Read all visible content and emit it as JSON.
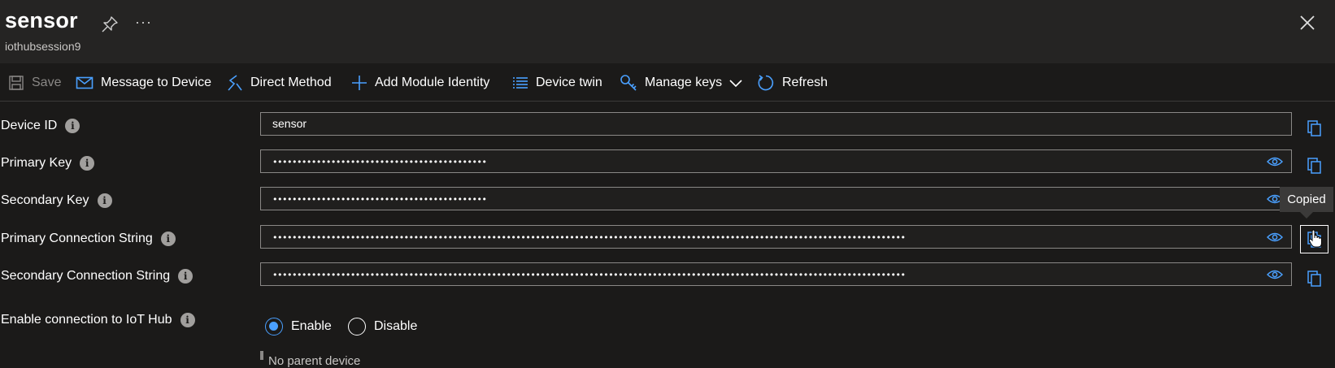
{
  "header": {
    "title": "sensor",
    "subtitle": "iothubsession9",
    "more": "···"
  },
  "toolbar": {
    "save": "Save",
    "message_to_device": "Message to Device",
    "direct_method": "Direct Method",
    "add_module_identity": "Add Module Identity",
    "device_twin": "Device twin",
    "manage_keys": "Manage keys",
    "refresh": "Refresh"
  },
  "form": {
    "device_id": {
      "label": "Device ID",
      "value": "sensor"
    },
    "primary_key": {
      "label": "Primary Key",
      "value": "••••••••••••••••••••••••••••••••••••••••••••"
    },
    "secondary_key": {
      "label": "Secondary Key",
      "value": "••••••••••••••••••••••••••••••••••••••••••••"
    },
    "primary_connection_string": {
      "label": "Primary Connection String",
      "value": "••••••••••••••••••••••••••••••••••••••••••••••••••••••••••••••••••••••••••••••••••••••••••••••••••••••••••••••••••••••••••••••••••"
    },
    "secondary_connection_string": {
      "label": "Secondary Connection String",
      "value": "••••••••••••••••••••••••••••••••••••••••••••••••••••••••••••••••••••••••••••••••••••••••••••••••••••••••••••••••••••••••••••••••••"
    },
    "enable_connection": {
      "label": "Enable connection to IoT Hub",
      "options": [
        "Enable",
        "Disable"
      ],
      "selected": "Enable"
    },
    "info_glyph": "i"
  },
  "tooltip": "Copied",
  "bottom_text": "No parent device",
  "colors": {
    "accent": "#4aa0ff",
    "background": "#1b1a19",
    "header": "#252423"
  }
}
